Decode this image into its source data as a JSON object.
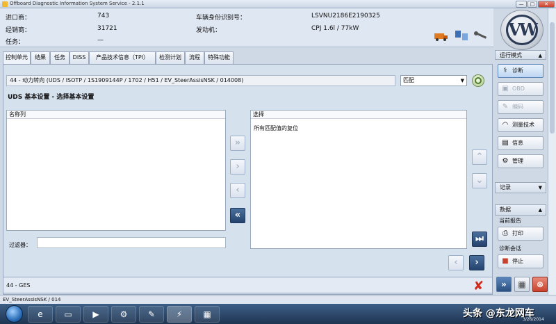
{
  "window": {
    "title": "Offboard Diagnostic Information System Service - 2.1.1",
    "controls": [
      "—",
      "□",
      "✕"
    ]
  },
  "header": {
    "importer_label": "进口商：",
    "importer_value": "743",
    "dealer_label": "经销商：",
    "dealer_value": "31721",
    "task_label": "任务：",
    "task_value": "—",
    "vin_label": "车辆身份识别号：",
    "vin_value": "LSVNU2186E2190325",
    "engine_label": "发动机：",
    "engine_value": "CPJ 1.6l / 77kW",
    "logo_text": "VW"
  },
  "tabs": [
    {
      "label": "控制单元"
    },
    {
      "label": "结果"
    },
    {
      "label": "任务"
    },
    {
      "label": "DISS"
    },
    {
      "label": "产品技术信息（TPI）"
    },
    {
      "label": "检测计划"
    },
    {
      "label": "流程"
    },
    {
      "label": "特殊功能"
    }
  ],
  "main": {
    "path": "44 - 动力转向 (UDS / ISOTP / 1S1909144P / 1702 / H51 / EV_SteerAssisNSK / 014008)",
    "select_value": "匹配",
    "section_title": "UDS 基本设置 - 选择基本设置",
    "left_list": {
      "header": "名称列"
    },
    "right_list": {
      "header": "选择",
      "items": [
        "所有匹配值的复位"
      ]
    },
    "filter_label": "过滤器：",
    "filter_value": ""
  },
  "status": {
    "left_text": "44 - GES",
    "footer_text": "EV_SteerAssisNSK / 014"
  },
  "sidebar": {
    "mode_header": "运行模式",
    "buttons": [
      {
        "label": "诊断",
        "icon": "stethoscope-icon",
        "glyph": "⚕"
      },
      {
        "label": "OBD",
        "icon": "obd-icon",
        "glyph": "▣"
      },
      {
        "label": "编码",
        "icon": "code-icon",
        "glyph": "✎"
      },
      {
        "label": "测量技术",
        "icon": "measure-icon",
        "glyph": "◠"
      },
      {
        "label": "信息",
        "icon": "info-book-icon",
        "glyph": "▤"
      },
      {
        "label": "管理",
        "icon": "admin-icon",
        "glyph": "⚙"
      }
    ],
    "record_header": "记录",
    "data_header": "数据",
    "current_log_label": "当前报告",
    "print_label": "打印",
    "session_label": "诊断会话",
    "stop_label": "停止"
  },
  "taskbar": {
    "overlay_text": "头条 @东龙网车",
    "date": "3/26/2014"
  },
  "colors": {
    "accent_blue": "#24436e",
    "cancel_red": "#d02a1a",
    "taskbar": "#1f3552"
  }
}
